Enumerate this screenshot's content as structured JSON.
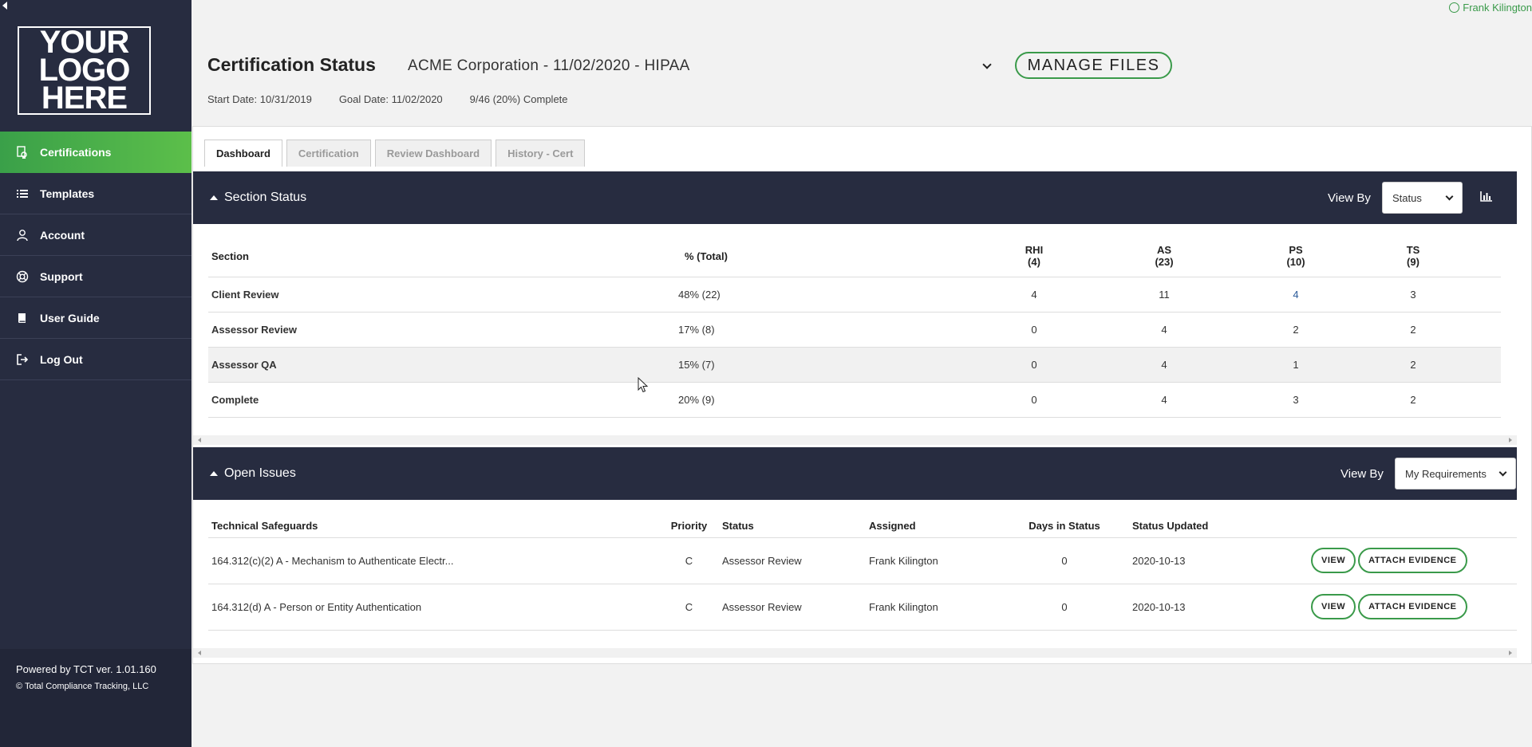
{
  "user": {
    "name": "Frank Kilington"
  },
  "logo": {
    "lines": [
      "YOUR",
      "LOGO",
      "HERE"
    ]
  },
  "sidebar": {
    "items": [
      {
        "label": "Certifications",
        "icon": "certificate-icon",
        "active": true
      },
      {
        "label": "Templates",
        "icon": "list-icon"
      },
      {
        "label": "Account",
        "icon": "user-icon"
      },
      {
        "label": "Support",
        "icon": "life-ring-icon"
      },
      {
        "label": "User Guide",
        "icon": "book-icon"
      },
      {
        "label": "Log Out",
        "icon": "sign-out-icon"
      }
    ],
    "powered": "Powered by TCT ver. 1.01.160",
    "copyright": "© Total Compliance Tracking, LLC"
  },
  "header": {
    "title": "Certification Status",
    "selected_cert": "ACME Corporation - 11/02/2020 - HIPAA",
    "manage_files": "MANAGE FILES",
    "start_date": "Start Date: 10/31/2019",
    "goal_date": "Goal Date: 11/02/2020",
    "progress": "9/46 (20%) Complete"
  },
  "tabs": [
    "Dashboard",
    "Certification",
    "Review Dashboard",
    "History - Cert"
  ],
  "section_status": {
    "title": "Section Status",
    "view_by_label": "View By",
    "view_by_value": "Status",
    "columns": {
      "section": "Section",
      "pct": "% (Total)",
      "rhi": "RHI",
      "rhi_count": "(4)",
      "as": "AS",
      "as_count": "(23)",
      "ps": "PS",
      "ps_count": "(10)",
      "ts": "TS",
      "ts_count": "(9)"
    },
    "rows": [
      {
        "section": "Client Review",
        "pct": "48%  (22)",
        "rhi": "4",
        "as": "11",
        "ps": "4",
        "ts": "3"
      },
      {
        "section": "Assessor Review",
        "pct": "17%  (8)",
        "rhi": "0",
        "as": "4",
        "ps": "2",
        "ts": "2"
      },
      {
        "section": "Assessor QA",
        "pct": "15%  (7)",
        "rhi": "0",
        "as": "4",
        "ps": "1",
        "ts": "2"
      },
      {
        "section": "Complete",
        "pct": "20%  (9)",
        "rhi": "0",
        "as": "4",
        "ps": "3",
        "ts": "2"
      }
    ]
  },
  "open_issues": {
    "title": "Open Issues",
    "view_by_label": "View By",
    "view_by_value": "My Requirements",
    "columns": {
      "name": "Technical Safeguards",
      "priority": "Priority",
      "status": "Status",
      "assigned": "Assigned",
      "days": "Days in Status",
      "updated": "Status Updated"
    },
    "rows": [
      {
        "name": "164.312(c)(2) A - Mechanism to Authenticate Electr...",
        "priority": "C",
        "status": "Assessor Review",
        "assigned": "Frank Kilington",
        "days": "0",
        "updated": "2020-10-13",
        "view": "VIEW",
        "attach": "ATTACH EVIDENCE"
      },
      {
        "name": "164.312(d) A - Person or Entity Authentication",
        "priority": "C",
        "status": "Assessor Review",
        "assigned": "Frank Kilington",
        "days": "0",
        "updated": "2020-10-13",
        "view": "VIEW",
        "attach": "ATTACH EVIDENCE"
      }
    ]
  },
  "colors": {
    "sidebar": "#272c40",
    "accent": "#3a9a4a",
    "link": "#2a5a99"
  }
}
